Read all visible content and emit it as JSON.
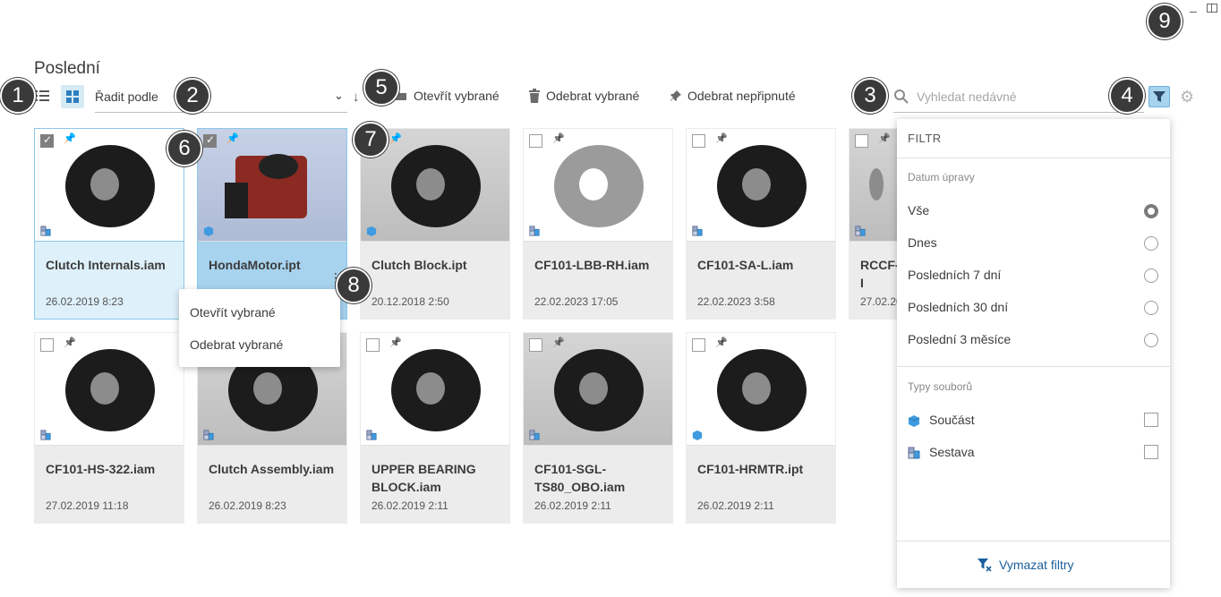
{
  "page": {
    "title": "Poslední"
  },
  "toolbar": {
    "sort_label": "Řadit podle",
    "open_selected": "Otevřít vybrané",
    "remove_selected": "Odebrat vybrané",
    "remove_unpinned": "Odebrat nepřipnuté",
    "search_placeholder": "Vyhledat nedávné"
  },
  "callouts": [
    "1",
    "2",
    "3",
    "4",
    "5",
    "6",
    "7",
    "8",
    "9"
  ],
  "files": [
    {
      "name": "Clutch Internals.iam",
      "date": "26.02.2019 8:23",
      "type": "assembly",
      "checked": true,
      "pinned": true
    },
    {
      "name": "HondaMotor.ipt",
      "date": "",
      "type": "part",
      "checked": true,
      "pinned": true
    },
    {
      "name": "Clutch Block.ipt",
      "date": "20.12.2018 2:50",
      "type": "part",
      "checked": false,
      "pinned": true
    },
    {
      "name": "CF101-LBB-RH.iam",
      "date": "22.02.2023 17:05",
      "type": "assembly",
      "checked": false,
      "pinned": false
    },
    {
      "name": "CF101-SA-L.iam",
      "date": "22.02.2023 3:58",
      "type": "assembly",
      "checked": false,
      "pinned": false
    },
    {
      "name": "RCCF-I",
      "date": "27.02.20",
      "type": "assembly",
      "checked": false,
      "pinned": false
    },
    {
      "name": "CF101-HS-322.iam",
      "date": "27.02.2019 11:18",
      "type": "assembly",
      "checked": false,
      "pinned": false
    },
    {
      "name": "Clutch Assembly.iam",
      "date": "26.02.2019 8:23",
      "type": "assembly",
      "checked": false,
      "pinned": false
    },
    {
      "name": "UPPER BEARING BLOCK.iam",
      "date": "26.02.2019 2:11",
      "type": "assembly",
      "checked": false,
      "pinned": false
    },
    {
      "name": "CF101-SGL-TS80_OBO.iam",
      "date": "26.02.2019 2:11",
      "type": "assembly",
      "checked": false,
      "pinned": false
    },
    {
      "name": "CF101-HRMTR.ipt",
      "date": "26.02.2019 2:11",
      "type": "part",
      "checked": false,
      "pinned": false
    }
  ],
  "context_menu": {
    "items": [
      "Otevřít vybrané",
      "Odebrat vybrané"
    ]
  },
  "filter": {
    "title": "FILTR",
    "date_section": "Datum úpravy",
    "date_options": [
      "Vše",
      "Dnes",
      "Posledních 7 dní",
      "Posledních 30 dní",
      "Poslední 3 měsíce"
    ],
    "date_selected": "Vše",
    "type_section": "Typy souborů",
    "type_options": [
      "Součást",
      "Sestava"
    ],
    "clear_label": "Vymazat filtry"
  },
  "colors": {
    "accent": "#1f89d6",
    "selected_bg": "#def0fa",
    "active_bg": "#a7d3ef",
    "callout": "#3a3a3a"
  }
}
